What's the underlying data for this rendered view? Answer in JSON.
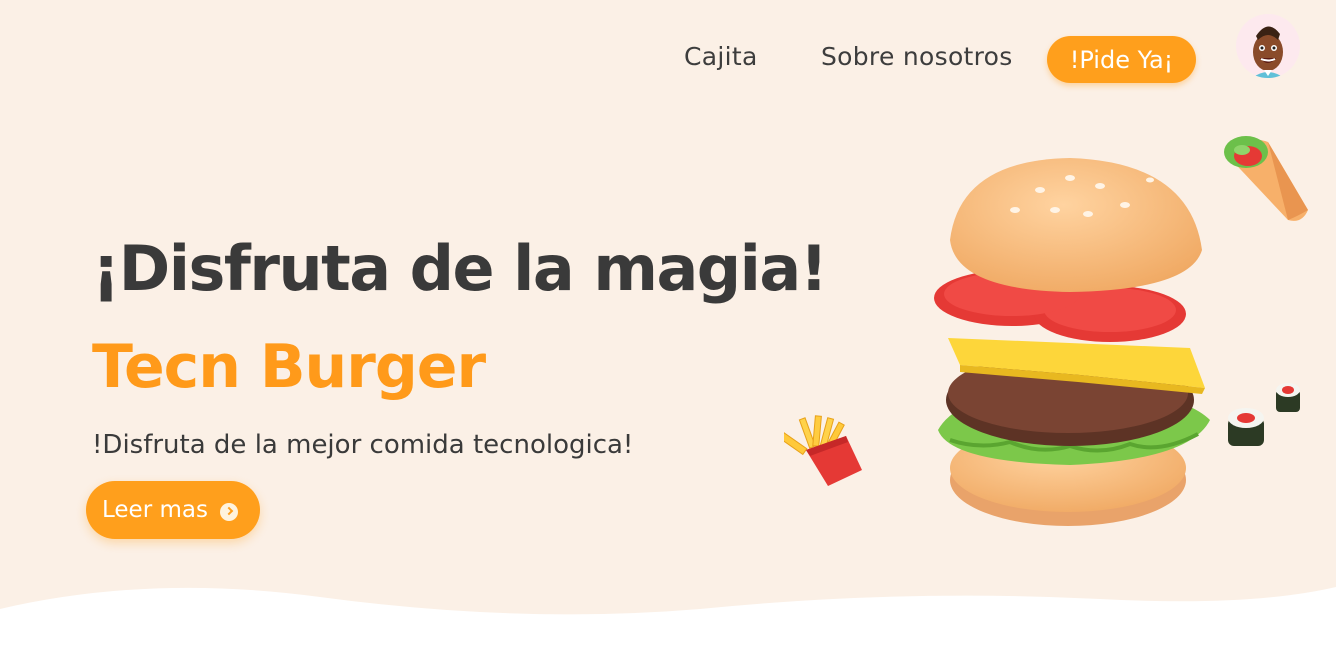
{
  "nav": {
    "links": [
      "Cajita",
      "Sobre nosotros"
    ],
    "cta": "!Pide  Ya¡"
  },
  "hero": {
    "title": "¡Disfruta de la magia!",
    "brand": "Tecn Burger",
    "subtitle": "!Disfruta de la mejor comida tecnologica!",
    "button": "Leer mas"
  },
  "colors": {
    "background": "#fbf0e6",
    "accent": "#ff9f1c",
    "text": "#3a3a3a"
  },
  "icons": [
    "avatar",
    "burger-image",
    "fries-image",
    "wrap-image",
    "sushi-image",
    "arrow-icon"
  ]
}
